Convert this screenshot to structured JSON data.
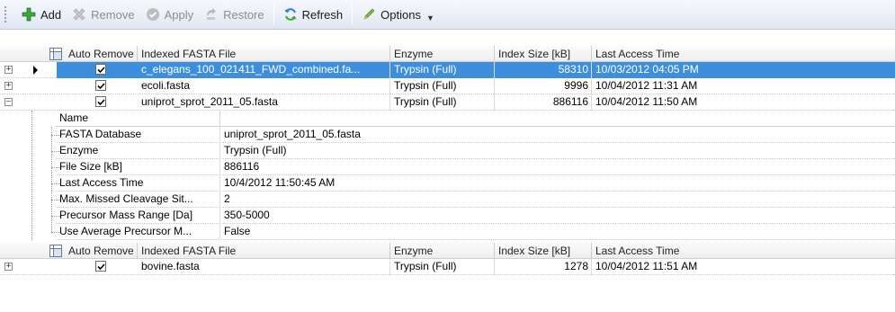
{
  "toolbar": {
    "add": "Add",
    "remove": "Remove",
    "apply": "Apply",
    "restore": "Restore",
    "refresh": "Refresh",
    "options": "Options"
  },
  "columns": {
    "auto_remove": "Auto Remove",
    "indexed_fasta_file": "Indexed FASTA File",
    "enzyme": "Enzyme",
    "index_size": "Index Size [kB]",
    "last_access_time": "Last Access Time"
  },
  "rows": [
    {
      "file": "c_elegans_100_021411_FWD_combined.fa...",
      "enzyme": "Trypsin (Full)",
      "size": "58310",
      "time": "10/03/2012 04:05 PM",
      "checked": true,
      "selected": true
    },
    {
      "file": "ecoli.fasta",
      "enzyme": "Trypsin (Full)",
      "size": "9996",
      "time": "10/04/2012 11:31 AM",
      "checked": true,
      "selected": false
    },
    {
      "file": "uniprot_sprot_2011_05.fasta",
      "enzyme": "Trypsin (Full)",
      "size": "886116",
      "time": "10/04/2012 11:50 AM",
      "checked": true,
      "selected": false
    }
  ],
  "detail": {
    "header": "Name",
    "items": [
      {
        "name": "FASTA Database",
        "value": "uniprot_sprot_2011_05.fasta"
      },
      {
        "name": "Enzyme",
        "value": "Trypsin (Full)"
      },
      {
        "name": "File Size [kB]",
        "value": "886116"
      },
      {
        "name": "Last Access Time",
        "value": "10/4/2012 11:50:45 AM"
      },
      {
        "name": "Max. Missed Cleavage Sit...",
        "value": "2"
      },
      {
        "name": "Precursor Mass Range [Da]",
        "value": "350-5000"
      },
      {
        "name": "Use Average Precursor M...",
        "value": "False"
      }
    ]
  },
  "rows2": [
    {
      "file": "bovine.fasta",
      "enzyme": "Trypsin (Full)",
      "size": "1278",
      "time": "10/04/2012 11:51 AM",
      "checked": true
    }
  ],
  "colors": {
    "selection": "#3d8fdd",
    "toolbar": "#e9eef7"
  }
}
